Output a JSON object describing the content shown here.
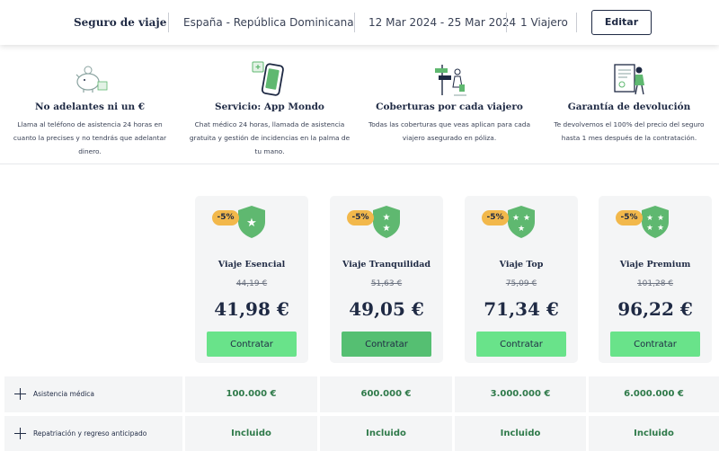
{
  "header": {
    "title": "Seguro de viaje",
    "route": "España - República Dominicana",
    "dates": "12 Mar 2024 - 25 Mar 2024",
    "travelers": "1 Viajero",
    "edit_label": "Editar"
  },
  "features": [
    {
      "icon": "piggy-bank-icon",
      "title": "No adelantes ni un €",
      "description": "Llama al teléfono de asistencia 24 horas en cuanto la precises y no tendrás que adelantar dinero."
    },
    {
      "icon": "phone-app-icon",
      "title": "Servicio: App Mondo",
      "description": "Chat médico 24 horas, llamada de asistencia gratuita y gestión de incidencias en la palma de tu mano."
    },
    {
      "icon": "signpost-travelers-icon",
      "title": "Coberturas por cada viajero",
      "description": "Todas las coberturas que veas aplican para cada viajero asegurado en póliza."
    },
    {
      "icon": "refund-document-icon",
      "title": "Garantía de devolución",
      "description": "Te devolvemos el 100% del precio del seguro hasta 1 mes después de la contratación."
    }
  ],
  "plans": [
    {
      "name": "Viaje Esencial",
      "discount": "-5%",
      "old_price": "44,19 €",
      "price": "41,98 €",
      "cta": "Contratar",
      "stars": 1
    },
    {
      "name": "Viaje Tranquilidad",
      "discount": "-5%",
      "old_price": "51,63 €",
      "price": "49,05 €",
      "cta": "Contratar",
      "stars": 2
    },
    {
      "name": "Viaje Top",
      "discount": "-5%",
      "old_price": "75,09 €",
      "price": "71,34 €",
      "cta": "Contratar",
      "stars": 3
    },
    {
      "name": "Viaje Premium",
      "discount": "-5%",
      "old_price": "101,28 €",
      "price": "96,22 €",
      "cta": "Contratar",
      "stars": 4
    }
  ],
  "coverage_rows": [
    {
      "label": "Asistencia médica",
      "values": [
        "100.000 €",
        "600.000 €",
        "3.000.000 €",
        "6.000.000 €"
      ]
    },
    {
      "label": "Repatriación y regreso anticipado",
      "values": [
        "Incluido",
        "Incluido",
        "Incluido",
        "Incluido"
      ]
    }
  ],
  "colors": {
    "navy": "#1f2a44",
    "cta_green": "#69e38a",
    "cta_green_hover": "#55bf72",
    "shield_green": "#5fb870",
    "discount_yellow": "#f2b84b",
    "value_green": "#2f7a4a"
  }
}
